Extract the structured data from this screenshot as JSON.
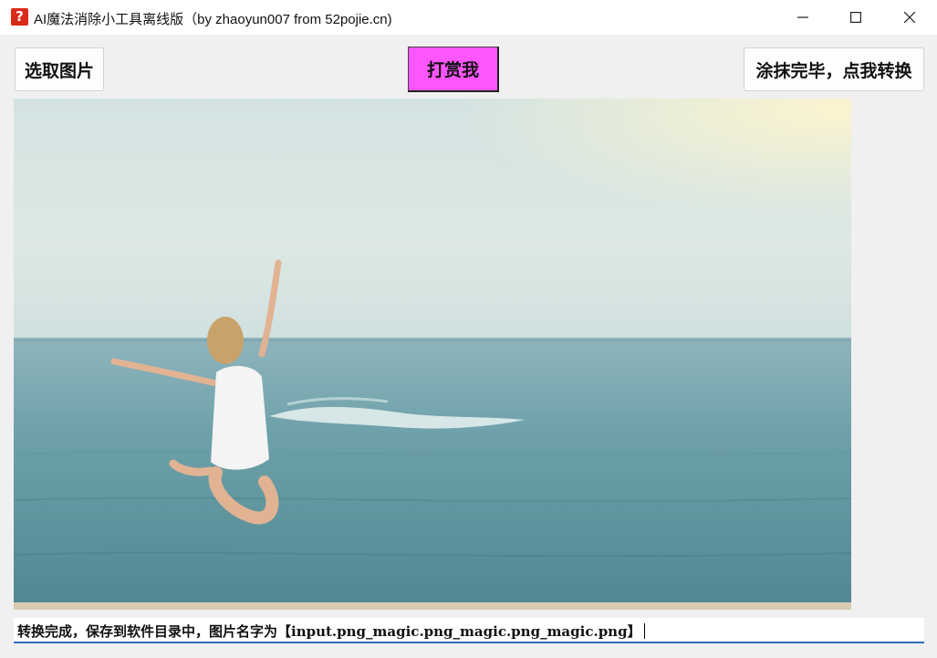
{
  "window": {
    "title": "AI魔法消除小工具离线版（by zhaoyun007 from 52pojie.cn)",
    "app_icon": "question-mark-icon"
  },
  "controls": {
    "minimize_icon": "minimize-icon",
    "maximize_icon": "maximize-icon",
    "close_icon": "close-icon"
  },
  "toolbar": {
    "select_label": "选取图片",
    "tip_label": "打赏我",
    "convert_label": "涂抹完毕，点我转换"
  },
  "status": {
    "text": "转换完成，保存到软件目录中，图片名字为【input.png_magic.png_magic.png_magic.png】"
  },
  "colors": {
    "tip_button": "#ff55ff",
    "status_underline": "#2a6fb8"
  }
}
